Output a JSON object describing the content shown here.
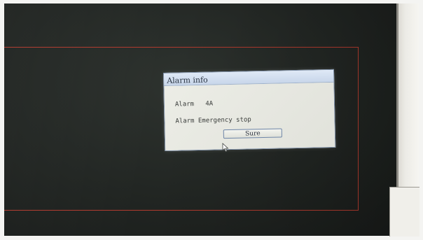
{
  "dialog": {
    "title": "Alarm info",
    "alarm_label": "Alarm",
    "alarm_code": "4A",
    "alarm_message_label": "Alarm",
    "alarm_message": "Emergency stop",
    "sure_button": "Sure"
  },
  "icons": {
    "cursor": "mouse-pointer-icon"
  },
  "colors": {
    "screen_background": "#212522",
    "work_area_border": "#b03a2e",
    "dialog_titlebar": "#c8d6ea",
    "dialog_body": "#e7e8e1"
  }
}
